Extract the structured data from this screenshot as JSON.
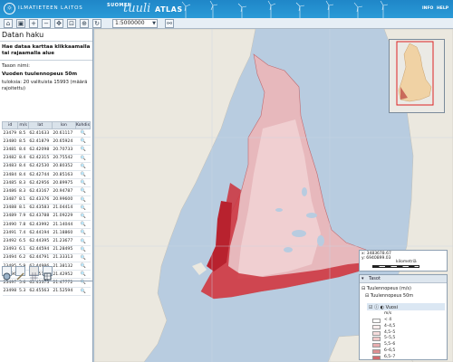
{
  "header": {
    "institute": "ILMATIETEEN LAITOS",
    "brand_suomen": "SUOMEN",
    "brand_tuuli": "tuuli",
    "brand_atlas": "ATLAS",
    "links": [
      "INFO",
      "HELP"
    ]
  },
  "toolbar": {
    "scale_value": "1:5000000",
    "buttons": [
      "home-icon",
      "zoom-box-icon",
      "zoom-in-icon",
      "zoom-out-icon",
      "pan-icon",
      "binoculars-icon"
    ]
  },
  "panel": {
    "title": "Datan haku",
    "hint": "Hae dataa karttaa klikkaamalla tai rajaamalla alue",
    "layer_label": "Tason nimi:",
    "layer_name": "Vuoden tuulennopeus 50m",
    "results": "tuloksia: 20 valituista 15993 (määrä rajoitettu)",
    "table": {
      "headers": [
        "id",
        "m/s",
        "lat",
        "lon",
        "Kohdis"
      ],
      "rows": [
        [
          "23479",
          "8.5",
          "62.41633",
          "20.61117"
        ],
        [
          "23480",
          "8.5",
          "62.41879",
          "20.65924"
        ],
        [
          "23481",
          "8.4",
          "62.42098",
          "20.70733"
        ],
        [
          "23482",
          "8.4",
          "62.42315",
          "20.75542"
        ],
        [
          "23483",
          "8.4",
          "62.42530",
          "20.80352"
        ],
        [
          "23484",
          "8.4",
          "62.42744",
          "20.85163"
        ],
        [
          "23485",
          "8.3",
          "62.42956",
          "20.89975"
        ],
        [
          "23486",
          "8.3",
          "62.43167",
          "20.94787"
        ],
        [
          "23487",
          "8.1",
          "62.43376",
          "20.99600"
        ],
        [
          "23488",
          "8.1",
          "62.43583",
          "21.04414"
        ],
        [
          "23489",
          "7.9",
          "62.43788",
          "21.09229"
        ],
        [
          "23490",
          "7.8",
          "62.43992",
          "21.14044"
        ],
        [
          "23491",
          "7.4",
          "62.44194",
          "21.18860"
        ],
        [
          "23492",
          "6.5",
          "62.44395",
          "21.23677"
        ],
        [
          "23493",
          "6.1",
          "62.44594",
          "21.28495"
        ],
        [
          "23494",
          "6.2",
          "62.44791",
          "21.33313"
        ],
        [
          "23495",
          "5.9",
          "62.44986",
          "21.38132"
        ],
        [
          "23496",
          "5.8",
          "62.45180",
          "21.42952"
        ],
        [
          "23497",
          "5.6",
          "62.45373",
          "21.47772"
        ],
        [
          "23498",
          "5.3",
          "62.45563",
          "21.52594"
        ]
      ]
    },
    "bottom_tools": [
      "globe-icon",
      "measure-icon",
      "grid-icon",
      "table-icon"
    ]
  },
  "coords": {
    "x": "x: 3483678.67",
    "y": "y: 6940899.03",
    "scale_unit": "kilometriä",
    "scale_ticks": [
      "0",
      "25",
      "50",
      "75",
      "100"
    ]
  },
  "layers": {
    "header": "Tasot",
    "group": "Tuulennopeus (m/s)",
    "layer": "Tuulennopeus 50m",
    "sublayer": "Vuosi",
    "legend_unit": "m/s",
    "legend": [
      {
        "label": "< 4",
        "color": "#ffffff"
      },
      {
        "label": "4–4,5",
        "color": "#fbeeee"
      },
      {
        "label": "4,5–5",
        "color": "#f6dcdc"
      },
      {
        "label": "5–5,5",
        "color": "#f0c8c8"
      },
      {
        "label": "5,5–6",
        "color": "#e8aeb0"
      },
      {
        "label": "6–6,5",
        "color": "#de8f92"
      },
      {
        "label": "6,5–7",
        "color": "#d26a6e"
      }
    ]
  }
}
